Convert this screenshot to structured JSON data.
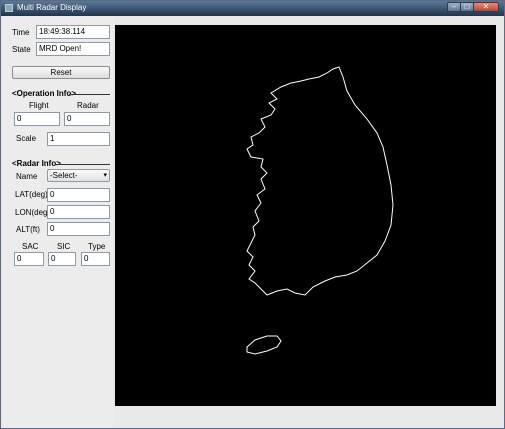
{
  "window": {
    "title": "Multi Radar Display"
  },
  "status": {
    "time_label": "Time",
    "time_value": "18:49:38.114",
    "state_label": "State",
    "state_value": "MRD Open!"
  },
  "reset_label": "Reset",
  "operation": {
    "header": "<Operation Info>",
    "flight_label": "Flight",
    "radar_label": "Radar",
    "flight_value": "0",
    "radar_value": "0",
    "scale_label": "Scale",
    "scale_value": "1"
  },
  "radar": {
    "header": "<Radar Info>",
    "name_label": "Name",
    "name_selected": "-Select-",
    "lat_label": "LAT(deg)",
    "lat_value": "0",
    "lon_label": "LON(deg)",
    "lon_value": "0",
    "alt_label": "ALT(ft)",
    "alt_value": "0",
    "sac_label": "SAC",
    "sic_label": "SIC",
    "type_label": "Type",
    "sac_value": "0",
    "sic_value": "0",
    "type_value": "0"
  },
  "map": {
    "background": "#000000",
    "outline_color": "#ffffff"
  }
}
